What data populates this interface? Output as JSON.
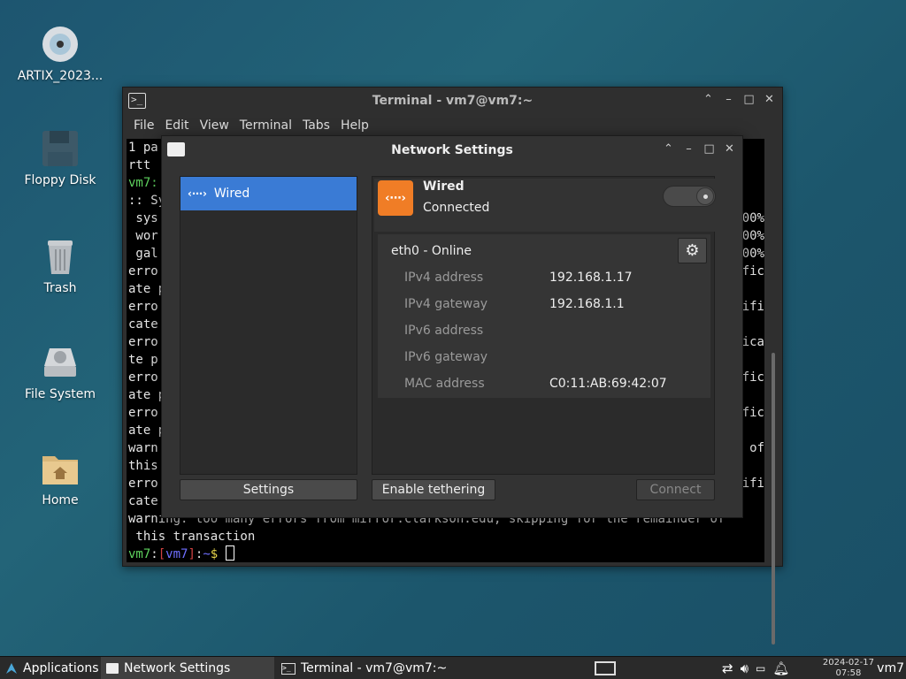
{
  "desktop": {
    "icons": [
      {
        "label": "ARTIX_2023...",
        "icon": "disc-icon"
      },
      {
        "label": "Floppy Disk",
        "icon": "floppy-icon"
      },
      {
        "label": "Trash",
        "icon": "trash-icon"
      },
      {
        "label": "File System",
        "icon": "drive-icon"
      },
      {
        "label": "Home",
        "icon": "home-folder-icon"
      }
    ]
  },
  "terminal": {
    "title": "Terminal - vm7@vm7:~",
    "menu": [
      "File",
      "Edit",
      "View",
      "Terminal",
      "Tabs",
      "Help"
    ],
    "left_lines": [
      "1 pa",
      "rtt",
      "vm7:",
      ":: Sy",
      " sys",
      " wor",
      " gal",
      "erro",
      "ate p",
      "erro",
      "cate",
      "erro",
      "te p",
      "erro",
      "ate p",
      "erro",
      "ate p",
      "warn",
      "this",
      "erro",
      "cate"
    ],
    "right_lines": [
      "",
      "",
      "",
      "",
      "00%",
      "00%",
      "00%",
      "fic",
      "",
      "ifi",
      "",
      "ica",
      "",
      "fic",
      "",
      "fic",
      "",
      "of",
      "",
      "ifi",
      ""
    ],
    "bottom_line_1": "warning: too many errors from mirror.clarkson.edu, skipping for the remainder of",
    "bottom_line_2": " this transaction",
    "prompt": {
      "user": "vm7",
      "host": "vm7",
      "path": "~",
      "symbol": "$"
    }
  },
  "network": {
    "title": "Network Settings",
    "connections": [
      {
        "label": "Wired",
        "icon": "wired-icon"
      }
    ],
    "settings_button": "Settings",
    "header": {
      "name": "Wired",
      "status": "Connected",
      "enabled": true
    },
    "interface": "eth0 - Online",
    "details": [
      {
        "key": "IPv4 address",
        "value": "192.168.1.17"
      },
      {
        "key": "IPv4 gateway",
        "value": "192.168.1.1"
      },
      {
        "key": "IPv6 address",
        "value": ""
      },
      {
        "key": "IPv6 gateway",
        "value": ""
      },
      {
        "key": "MAC address",
        "value": "C0:11:AB:69:42:07"
      }
    ],
    "tethering_button": "Enable tethering",
    "connect_button": "Connect",
    "accent_color": "#f07d26",
    "selection_color": "#3a7bd5"
  },
  "taskbar": {
    "applications": "Applications",
    "tasks": [
      {
        "label": "Network Settings",
        "active": true
      },
      {
        "label": "Terminal - vm7@vm7:~",
        "active": false
      }
    ],
    "date": "2024-02-17",
    "time": "07:58",
    "user": "vm7"
  }
}
